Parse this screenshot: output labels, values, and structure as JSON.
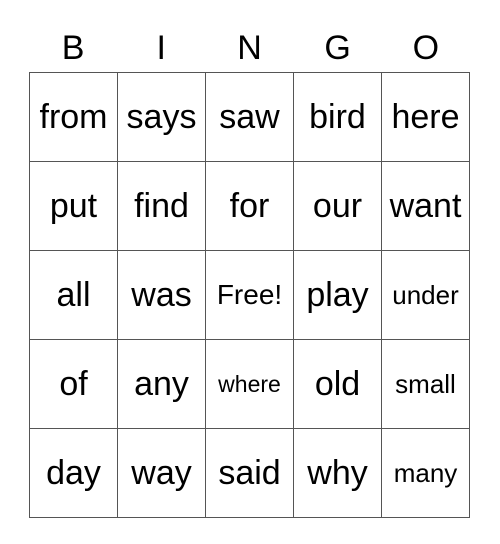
{
  "header": [
    "B",
    "I",
    "N",
    "G",
    "O"
  ],
  "rows": [
    [
      "from",
      "says",
      "saw",
      "bird",
      "here"
    ],
    [
      "put",
      "find",
      "for",
      "our",
      "want"
    ],
    [
      "all",
      "was",
      "Free!",
      "play",
      "under"
    ],
    [
      "of",
      "any",
      "where",
      "old",
      "small"
    ],
    [
      "day",
      "way",
      "said",
      "why",
      "many"
    ]
  ]
}
